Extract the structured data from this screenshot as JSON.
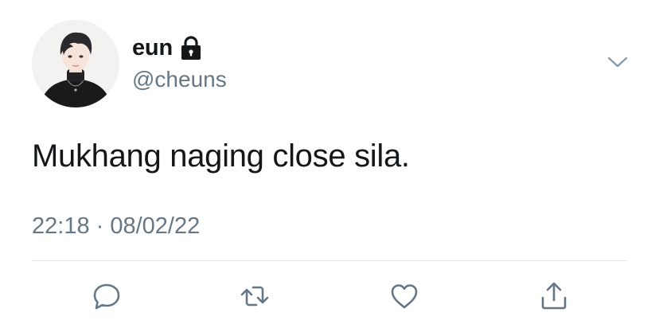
{
  "tweet": {
    "display_name": "eun",
    "username": "@cheuns",
    "text": "Mukhang naging close sila.",
    "timestamp": "22:18 · 08/02/22",
    "protected": true
  },
  "icons": {
    "lock": "lock-icon",
    "menu": "chevron-down-icon",
    "reply": "reply-icon",
    "retweet": "retweet-icon",
    "like": "heart-icon",
    "share": "share-icon"
  },
  "colors": {
    "text_primary": "#14171a",
    "text_secondary": "#657786",
    "icon_gray": "#657786",
    "divider": "#e1e8ed"
  }
}
